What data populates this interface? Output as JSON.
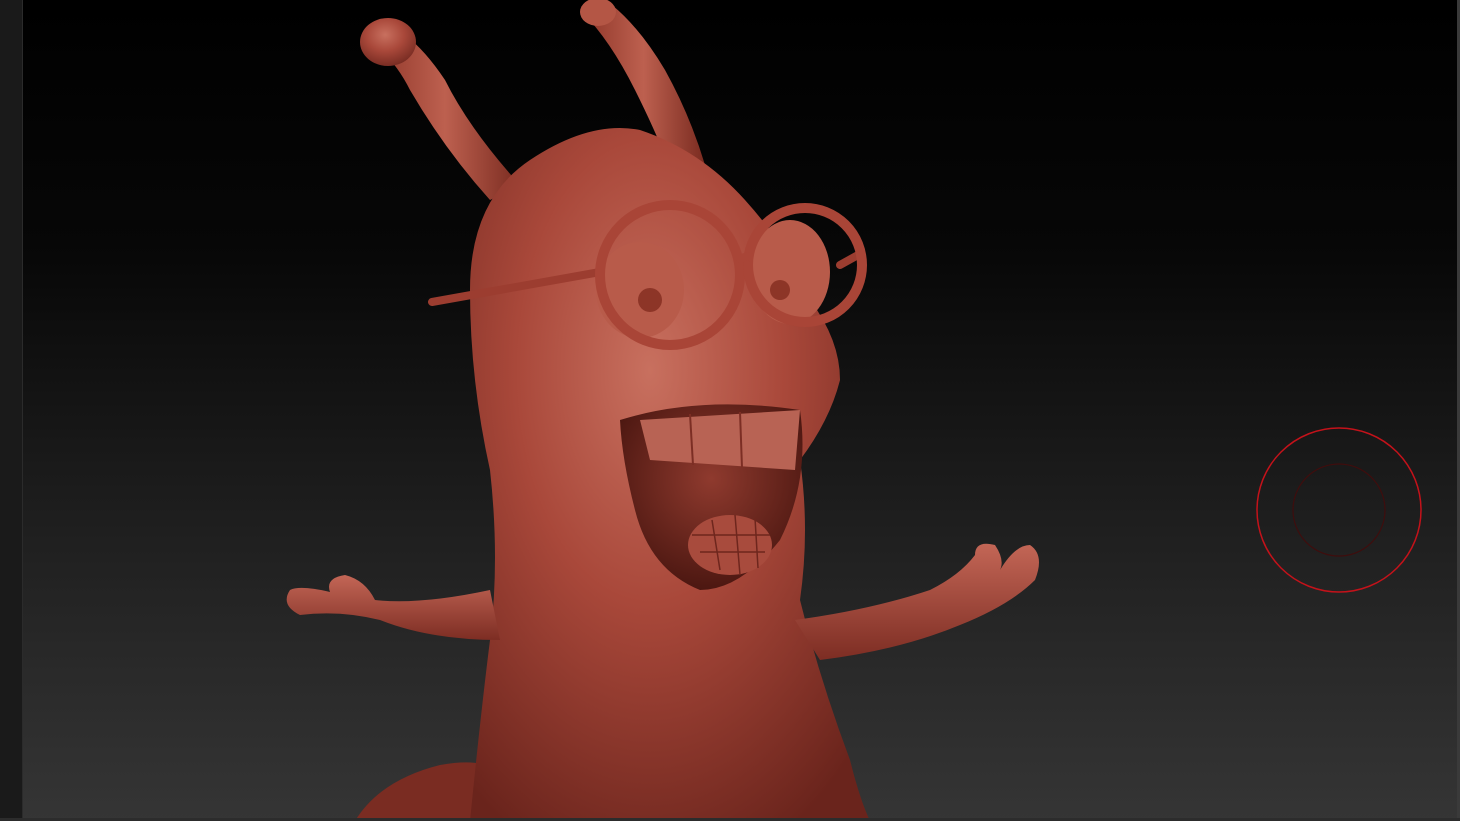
{
  "viewport": {
    "background_top": "#000000",
    "background_bottom": "#353535"
  },
  "model": {
    "subject": "slug-character-with-glasses",
    "material_color": "#a9483a",
    "shadow_color": "#5e2019",
    "highlight_color": "#c96a59"
  },
  "brush": {
    "outer_ring_color": "#c4121a",
    "inner_ring_color": "#3f0d0d"
  }
}
